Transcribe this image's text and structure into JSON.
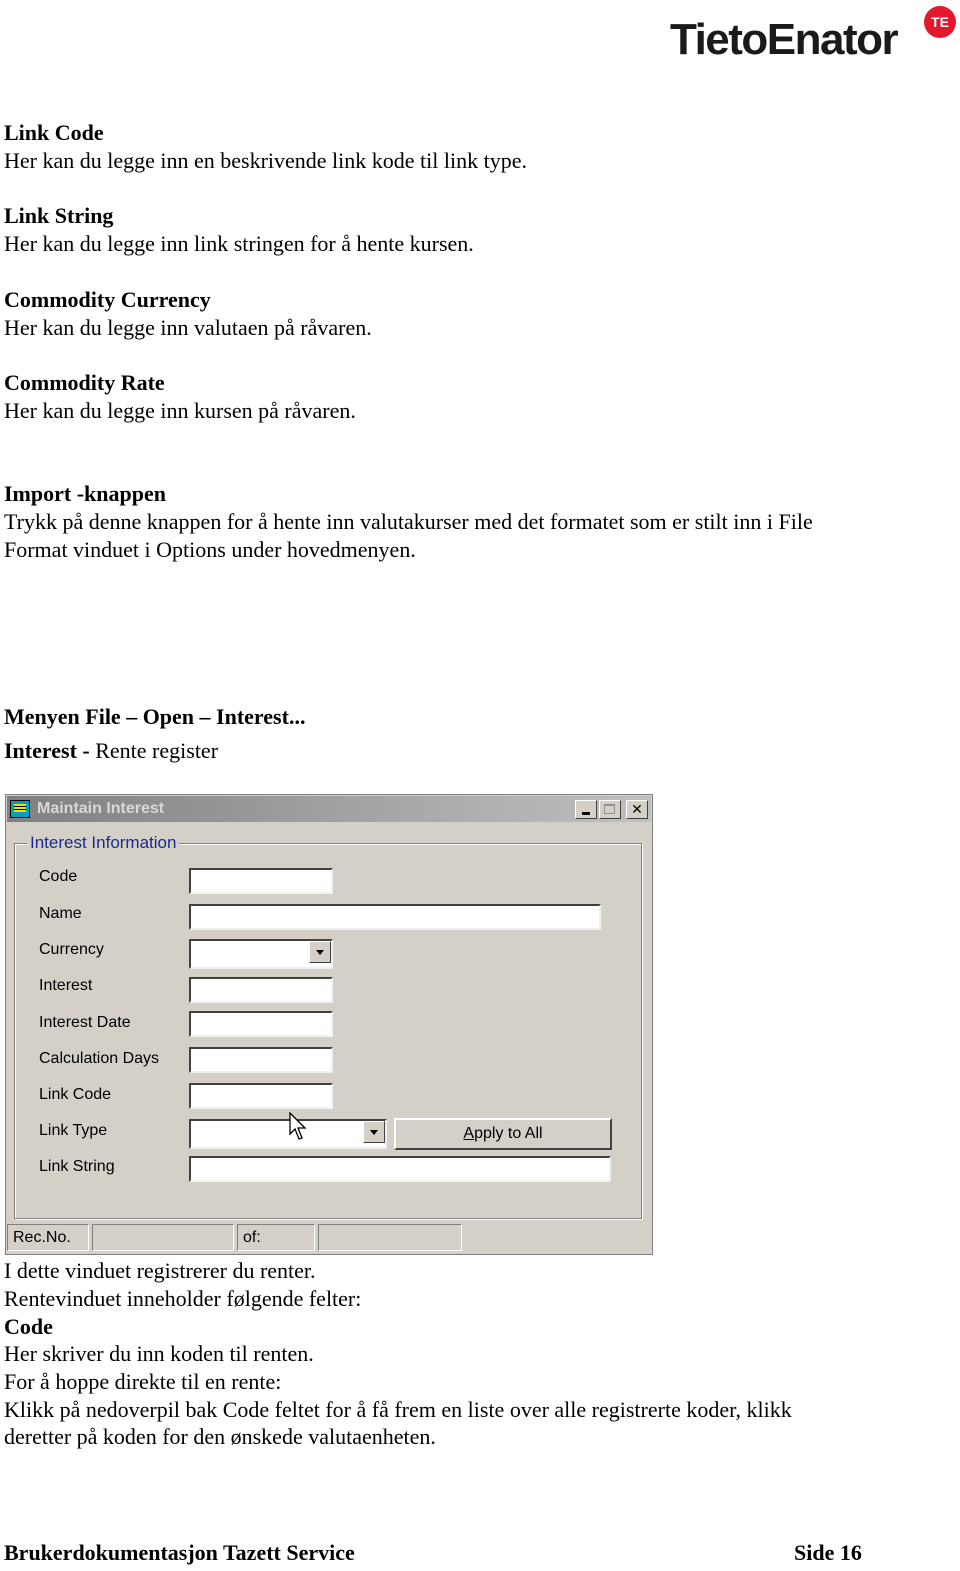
{
  "header": {
    "logo_text": "TietoEnator",
    "logo_badge": "TE",
    "brand_color": "#e3182d"
  },
  "sections": [
    {
      "heading": "Link Code",
      "text": "Her kan du legge inn en beskrivende link kode til link type."
    },
    {
      "heading": "Link String",
      "text": "Her kan du legge inn link stringen for å hente kursen."
    },
    {
      "heading": "Commodity Currency",
      "text": "Her kan du legge inn valutaen på råvaren."
    },
    {
      "heading": "Commodity Rate",
      "text": "Her kan du legge inn kursen på råvaren."
    },
    {
      "heading": "Import -knappen",
      "lines": [
        "Trykk på denne knappen for å hente inn valutakurser med det formatet som er stilt inn i File",
        "Format vinduet i Options under hovedmenyen."
      ]
    }
  ],
  "menu_heading": "Menyen File – Open – Interest...",
  "interest_heading": {
    "bold": "Interest -",
    "normal": "Rente register"
  },
  "window": {
    "title": "Maintain Interest",
    "group_title": "Interest Information",
    "fields": [
      {
        "label": "Code",
        "value": ""
      },
      {
        "label": "Name",
        "value": ""
      },
      {
        "label": "Currency",
        "value": ""
      },
      {
        "label": "Interest",
        "value": ""
      },
      {
        "label": "Interest Date",
        "value": ""
      },
      {
        "label": "Calculation Days",
        "value": ""
      },
      {
        "label": "Link Code",
        "value": ""
      },
      {
        "label": "Link Type",
        "value": ""
      },
      {
        "label": "Link String",
        "value": ""
      }
    ],
    "apply_button": {
      "accel": "A",
      "rest": "pply to All"
    },
    "status": {
      "rec_label": "Rec.No.",
      "rec_value": "",
      "of_label": "of:",
      "of_value": ""
    }
  },
  "body_after": [
    {
      "text": "I dette vinduet registrerer du renter.",
      "bold": false
    },
    {
      "text": "Rentevinduet inneholder følgende felter:",
      "bold": false
    },
    {
      "text": "Code",
      "bold": true
    },
    {
      "text": "Her skriver du inn koden til renten.",
      "bold": false
    },
    {
      "text": "For å hoppe direkte til en rente:",
      "bold": false
    },
    {
      "text": "Klikk på nedoverpil bak Code feltet for å få frem en liste over alle registrerte koder, klikk",
      "bold": false
    },
    {
      "text": "deretter på koden for den ønskede valutaenheten.",
      "bold": false
    }
  ],
  "footer": {
    "left": "Brukerdokumentasjon Tazett Service",
    "right": "Side 16"
  }
}
